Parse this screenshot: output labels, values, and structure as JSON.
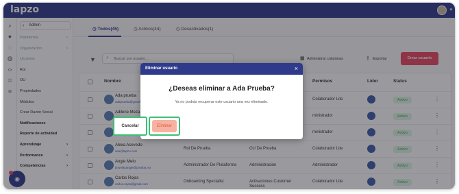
{
  "app": {
    "logo": "lapzo"
  },
  "sidebar": {
    "header": "Admin",
    "items": [
      {
        "label": "Plataforma",
        "faded": true,
        "arrow": true
      },
      {
        "label": "Organización",
        "faded": true,
        "arrow": true
      },
      {
        "label": "Usuarios",
        "faded": true,
        "arrow": false
      },
      {
        "label": "Rol",
        "faded": false,
        "arrow": false
      },
      {
        "label": "OU",
        "faded": false,
        "arrow": false
      },
      {
        "label": "Propiedades",
        "faded": false,
        "arrow": false
      },
      {
        "label": "Módulos",
        "faded": false,
        "arrow": false
      },
      {
        "label": "Crear Razón Social",
        "faded": false,
        "arrow": false
      },
      {
        "label": "Notificaciones",
        "bold": true,
        "arrow": false
      },
      {
        "label": "Reporte de actividad",
        "bold": true,
        "arrow": false
      },
      {
        "label": "Aprendizaje",
        "bold": true,
        "arrow": true
      },
      {
        "label": "Performance",
        "bold": true,
        "arrow": true
      },
      {
        "label": "Competencias",
        "bold": true,
        "arrow": true
      }
    ]
  },
  "tabs": [
    {
      "label": "Todos(45)",
      "active": true
    },
    {
      "label": "Activos(44)",
      "active": false
    },
    {
      "label": "Desactivados(1)",
      "active": false
    }
  ],
  "toolbar": {
    "search_placeholder": "Buscar por usuario...",
    "columns_label": "Administrar columnas",
    "export_label": "Exportar",
    "create_label": "Crear usuario"
  },
  "table": {
    "headers": {
      "name": "Nombre",
      "profile": "Permisos",
      "leader": "Lider",
      "status": "Status"
    },
    "rows": [
      {
        "name": "Ada prueba",
        "email": "adaprueba@gmail.com",
        "role": "",
        "ou": "",
        "profile": "Colaborador Lite",
        "status": "Activo"
      },
      {
        "name": "Adilene Meza",
        "email": "jmunoz@pruebalapzo.com",
        "role": "",
        "ou": "",
        "profile": "ministrador",
        "status": "Activo"
      },
      {
        "name": "Admin Lapzo",
        "email": "admin@lapzo.com",
        "role": "",
        "ou": "",
        "profile": "ministrador",
        "status": "Activo"
      },
      {
        "name": "Alexa Acevedo",
        "email": "aca@lapzo.com",
        "role": "Rol De Prueba",
        "ou": "OU De Prueba",
        "profile": "Colaborador Lite",
        "status": "Activo"
      },
      {
        "name": "Angie Melo",
        "email": "jmuelasangie@prueba.mx",
        "role": "Administrador De Plataforma",
        "ou": "Administración",
        "profile": "Administrador",
        "status": "Activo"
      },
      {
        "name": "Carlos Rojas",
        "email": "carlos.rojas@gmail.com",
        "role": "Onboarding Specialist",
        "ou": "Activaciones Customer Success",
        "profile": "Colaborador Lite",
        "status": "Activo"
      }
    ]
  },
  "modal": {
    "title": "Eliminar usuario",
    "question": "¿Deseas eliminar a Ada Prueba?",
    "note": "Ya no podrás recuperar este usuario una vez eliminado.",
    "cancel_label": "Cancelar",
    "delete_label": "Eliminar"
  },
  "colors": {
    "brand": "#2f3a8a",
    "accent": "#e94560",
    "status_active": "#3ba55a",
    "highlight": "#3fbf74"
  }
}
